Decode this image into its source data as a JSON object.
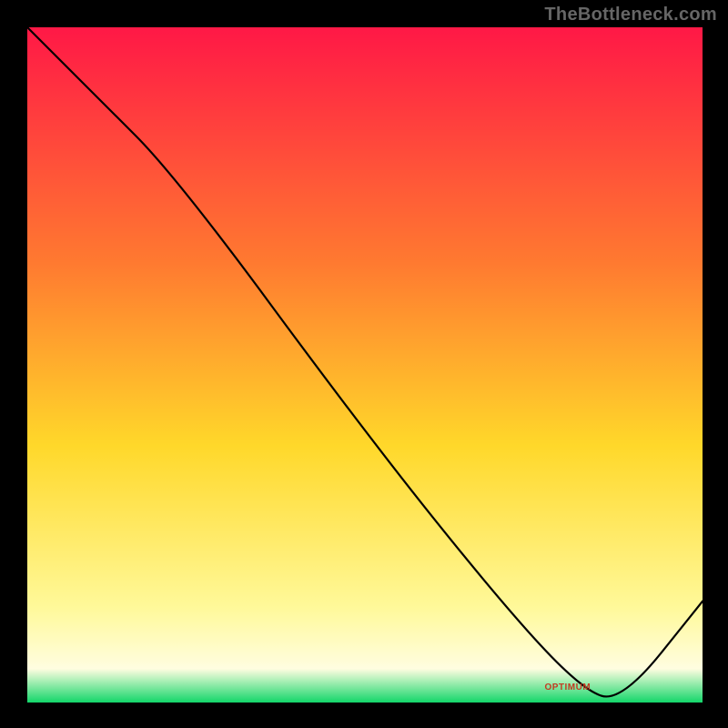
{
  "watermark": "TheBottleneck.com",
  "annotation": "OPTIMUM",
  "colors": {
    "top": "#ff1846",
    "mid1": "#ff7a30",
    "mid2": "#ffd82a",
    "mid3": "#fff99a",
    "bottom": "#13d66a"
  },
  "chart_data": {
    "type": "line",
    "title": "",
    "xlabel": "",
    "ylabel": "",
    "xlim": [
      0,
      100
    ],
    "ylim": [
      0,
      100
    ],
    "x": [
      0,
      10,
      22,
      50,
      70,
      82,
      88,
      100
    ],
    "values": [
      100,
      90,
      78,
      40,
      15,
      2,
      0,
      15
    ],
    "optimum_x": 82,
    "note": "Values estimated from pixel positions; monotone descent with an inflection near x≈22, a minimum near x≈82–88, then a rise to the right edge."
  }
}
